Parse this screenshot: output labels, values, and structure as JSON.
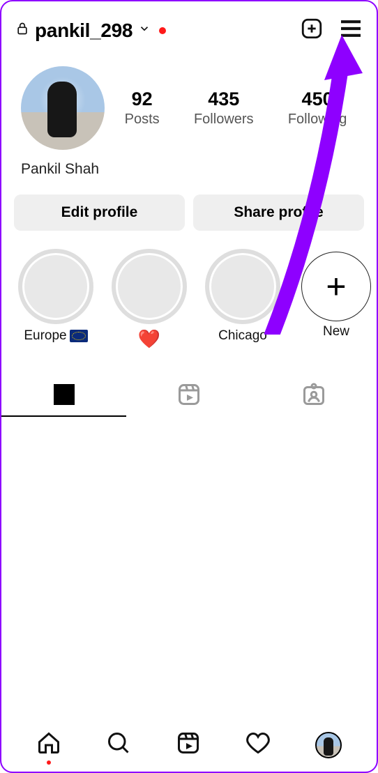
{
  "header": {
    "username": "pankil_298"
  },
  "profile": {
    "display_name": "Pankil Shah",
    "stats": {
      "posts": {
        "count": "92",
        "label": "Posts"
      },
      "followers": {
        "count": "435",
        "label": "Followers"
      },
      "following": {
        "count": "450",
        "label": "Following"
      }
    }
  },
  "buttons": {
    "edit": "Edit profile",
    "share": "Share profile"
  },
  "highlights": [
    {
      "label": "Europe"
    },
    {
      "label": "❤️"
    },
    {
      "label": "Chicago"
    },
    {
      "label": "New",
      "is_new": true
    }
  ],
  "annotation": {
    "color": "#8e00ff"
  }
}
